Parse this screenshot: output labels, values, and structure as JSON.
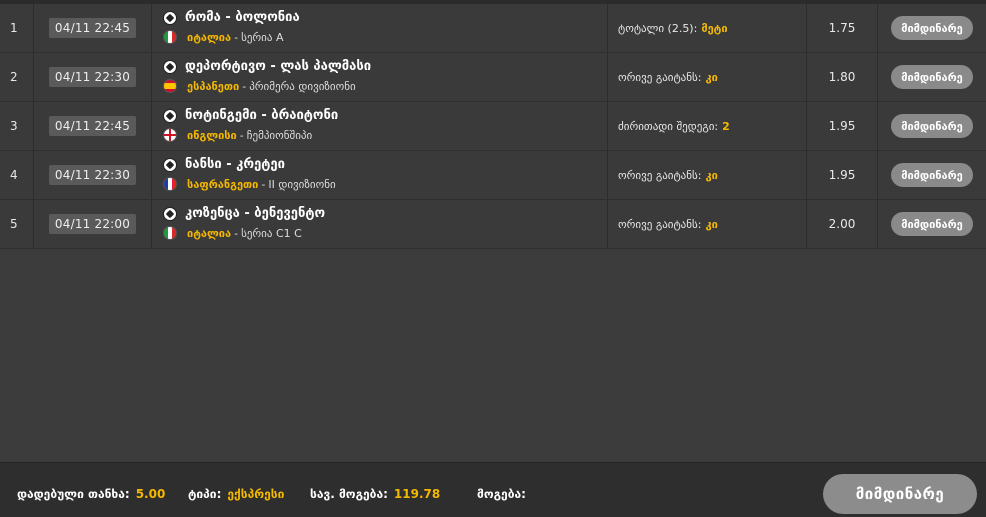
{
  "rows": [
    {
      "num": "1",
      "time": "04/11 22:45",
      "match": "რომა - ბოლონია",
      "flag": "italy-flag-icon",
      "country": "იტალია",
      "league": "სერია A",
      "bet_label": "ტოტალი (2.5):",
      "bet_value": "მეტი",
      "odds": "1.75",
      "status": "მიმდინარე"
    },
    {
      "num": "2",
      "time": "04/11 22:30",
      "match": "დეპორტივო - ლას პალმასი",
      "flag": "spain-flag-icon",
      "country": "ესპანეთი",
      "league": "პრიმერა დივიზიონი",
      "bet_label": "ორივე გაიტანს:",
      "bet_value": "კი",
      "odds": "1.80",
      "status": "მიმდინარე"
    },
    {
      "num": "3",
      "time": "04/11 22:45",
      "match": "ნოტინგემი - ბრაიტონი",
      "flag": "england-flag-icon",
      "country": "ინგლისი",
      "league": "ჩემპიონშიპი",
      "bet_label": "ძირითადი შედეგი:",
      "bet_value": "2",
      "odds": "1.95",
      "status": "მიმდინარე"
    },
    {
      "num": "4",
      "time": "04/11 22:30",
      "match": "ნანსი - კრეტეი",
      "flag": "france-flag-icon",
      "country": "საფრანგეთი",
      "league": "II დივიზიონი",
      "bet_label": "ორივე გაიტანს:",
      "bet_value": "კი",
      "odds": "1.95",
      "status": "მიმდინარე"
    },
    {
      "num": "5",
      "time": "04/11 22:00",
      "match": "კოზენცა - ბენევენტო",
      "flag": "italy-flag-icon",
      "country": "იტალია",
      "league": "სერია C1 C",
      "bet_label": "ორივე გაიტანს:",
      "bet_value": "კი",
      "odds": "2.00",
      "status": "მიმდინარე"
    }
  ],
  "footer": {
    "stake_label": "დადებული თანხა:",
    "stake_value": "5.00",
    "type_label": "ტიპი:",
    "type_value": "ექსპრესი",
    "potential_label": "სავ. მოგება:",
    "potential_value": "119.78",
    "win_label": "მოგება:",
    "win_value": "",
    "status_button": "მიმდინარე"
  },
  "colors": {
    "accent": "#f5b800",
    "background": "#3a3a3a",
    "pill": "#8a8a8a"
  }
}
